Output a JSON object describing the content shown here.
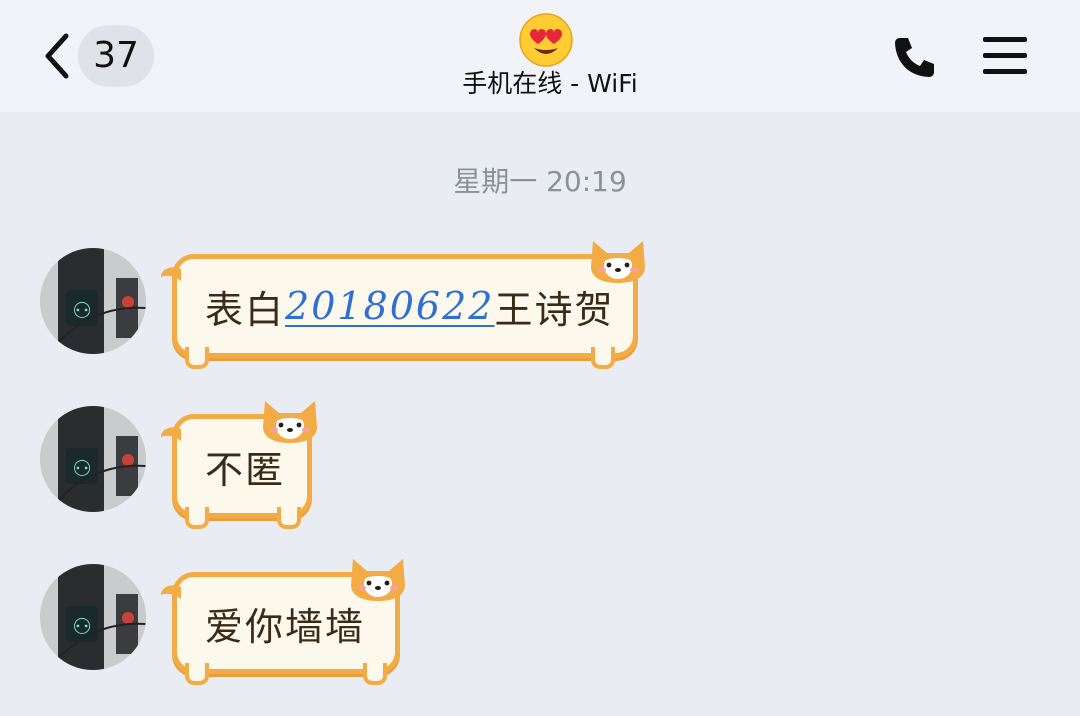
{
  "header": {
    "back_icon": "chevron-left-icon",
    "unread_count": "37",
    "title_emoji": "heart-eyes-emoji",
    "status": "手机在线 - WiFi",
    "phone_icon": "phone-icon",
    "menu_icon": "hamburger-menu-icon"
  },
  "chat": {
    "timestamp": "星期一 20:19",
    "messages": [
      {
        "sender": "contact",
        "avatar_icon": "traffic-light-avatar",
        "text_before": "表白",
        "link": "20180622",
        "text_after": "王诗贺",
        "bubble_style": "corgi-bubble"
      },
      {
        "sender": "contact",
        "avatar_icon": "traffic-light-avatar",
        "text": "不匿",
        "bubble_style": "corgi-bubble"
      },
      {
        "sender": "contact",
        "avatar_icon": "traffic-light-avatar",
        "text": "爱你墙墙",
        "bubble_style": "corgi-bubble"
      }
    ]
  },
  "colors": {
    "background": "#e9ecf3",
    "header_background": "#f1f3f8",
    "bubble_border": "#f2ab45",
    "bubble_fill": "#fdf8ec",
    "link": "#2f6fd3",
    "timestamp": "#8c9099"
  }
}
